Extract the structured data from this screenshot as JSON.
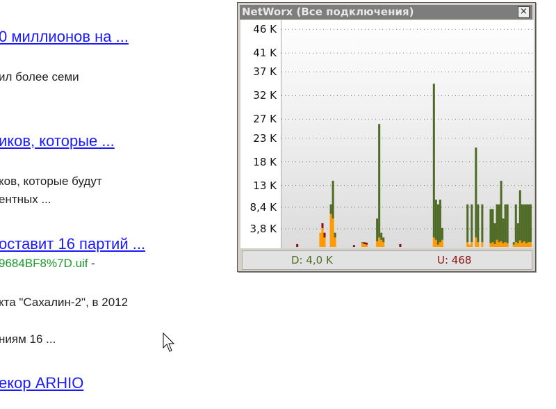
{
  "results": [
    {
      "link": "0 миллионов на ...",
      "snippets": [
        "ил более семи"
      ]
    },
    {
      "link": "иков, которые ...",
      "snippets": [
        "ков, которые будут",
        "ентных ..."
      ]
    },
    {
      "link": "оставит 16 партий ...",
      "url": "9684BF8%7D.uif",
      "url_suffix": "-",
      "snippets": [
        "кта \"Сахалин-2\", в 2012",
        "ниям 16 ..."
      ]
    },
    {
      "link": "екор ARHIO"
    }
  ],
  "widget": {
    "title": "NetWorx (Все подключения)",
    "close": "×",
    "download_label": "D: 4,0 K",
    "upload_label": "U: 468",
    "colors": {
      "download": "#4f6b26",
      "upload": "#8b1010",
      "overlap": "#ff9a00"
    }
  },
  "chart_data": {
    "type": "bar",
    "ylabel": "",
    "ytick_labels": [
      "46 K",
      "41 K",
      "37 K",
      "32 K",
      "27 K",
      "23 K",
      "18 K",
      "13 K",
      "8,4 K",
      "3,8 K"
    ],
    "yticks": [
      46,
      41,
      37,
      32,
      27,
      23,
      18,
      13,
      8.4,
      3.8
    ],
    "ylim": [
      0,
      48
    ],
    "samples": 120,
    "series": [
      {
        "name": "download",
        "points": [
          [
            7,
            0,
            0.6
          ],
          [
            18,
            3,
            3
          ],
          [
            19,
            4,
            5
          ],
          [
            20,
            2,
            3
          ],
          [
            23,
            9,
            7
          ],
          [
            24,
            14,
            6
          ],
          [
            25,
            3,
            2
          ],
          [
            34,
            0,
            0.4
          ],
          [
            38,
            1,
            0.8
          ],
          [
            39,
            0.6,
            1
          ],
          [
            40,
            0.5,
            0.9
          ],
          [
            45,
            6,
            1.2
          ],
          [
            46,
            26,
            2
          ],
          [
            47,
            3,
            1.5
          ],
          [
            48,
            2,
            1
          ],
          [
            56,
            0,
            0.6
          ],
          [
            72,
            34.5,
            2
          ],
          [
            73,
            10,
            1.5
          ],
          [
            74,
            9,
            0.5
          ],
          [
            75,
            10,
            1
          ],
          [
            76,
            4,
            1.5
          ],
          [
            88,
            9,
            1
          ],
          [
            89,
            0.5,
            0.5
          ],
          [
            90,
            9,
            1
          ],
          [
            92,
            21,
            2
          ],
          [
            93,
            9,
            1
          ],
          [
            95,
            9,
            1
          ],
          [
            99,
            8,
            0.8
          ],
          [
            100,
            8,
            1
          ],
          [
            101,
            5,
            0.6
          ],
          [
            102,
            9,
            1.5
          ],
          [
            103,
            9,
            1
          ],
          [
            104,
            14,
            1.2
          ],
          [
            105,
            6,
            0.8
          ],
          [
            106,
            9,
            1
          ],
          [
            107,
            9,
            0.8
          ],
          [
            110,
            1,
            0.5
          ],
          [
            111,
            9,
            1
          ],
          [
            112,
            5,
            0.8
          ],
          [
            113,
            12,
            1.4
          ],
          [
            114,
            9,
            0.9
          ],
          [
            115,
            9,
            1.2
          ],
          [
            116,
            9,
            0.8
          ],
          [
            117,
            9,
            1
          ],
          [
            118,
            9,
            1
          ]
        ]
      }
    ]
  }
}
